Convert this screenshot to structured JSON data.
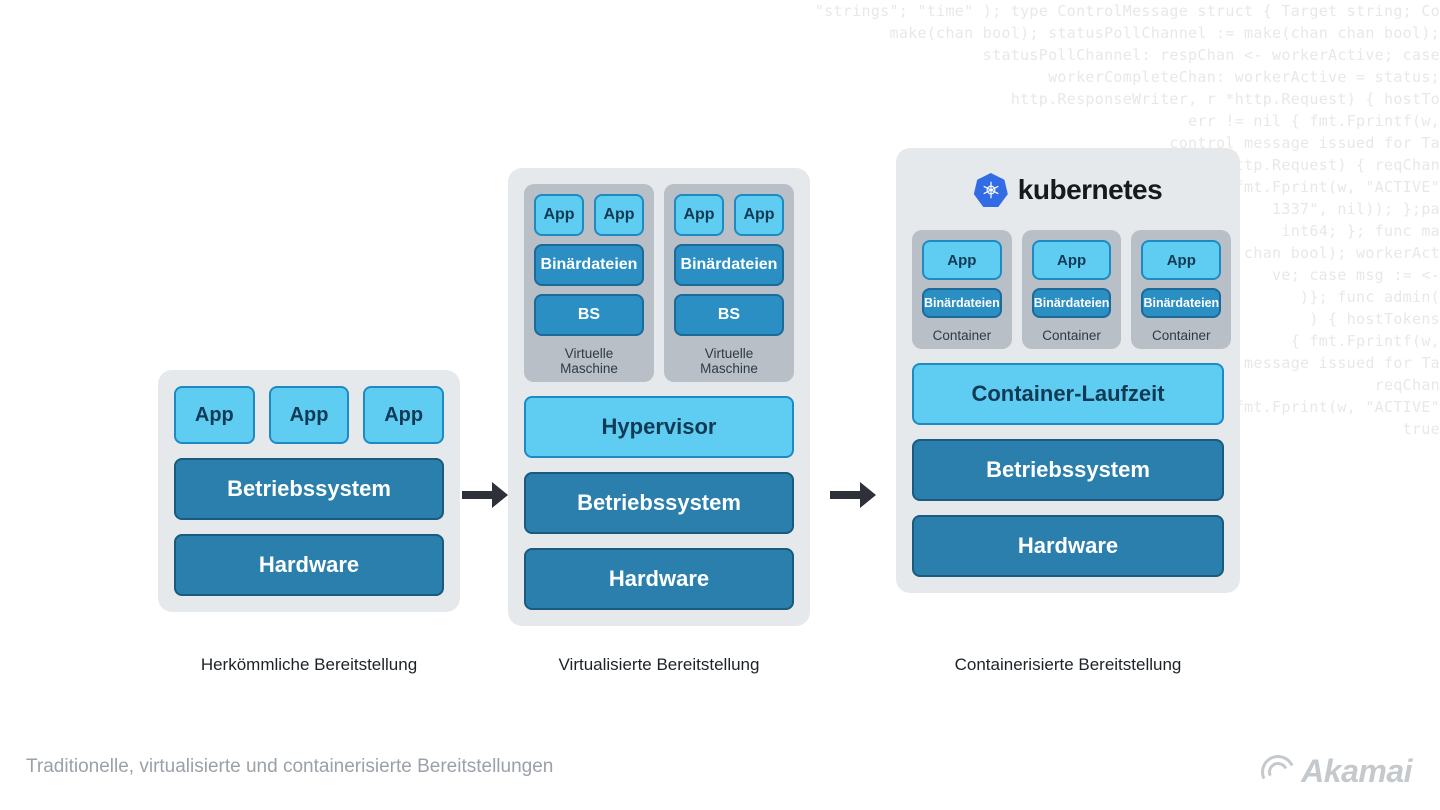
{
  "background_code": "\"strings\"; \"time\" ); type ControlMessage struct { Target string; Co\nmake(chan bool); statusPollChannel := make(chan chan bool);\nstatusPollChannel: respChan <- workerActive; case\nworkerCompleteChan: workerActive = status;\nhttp.ResponseWriter, r *http.Request) { hostTo\n  err != nil { fmt.Fprintf(w,\n  control message issued for Ta\n  http.Request) { reqChan\n  fmt.Fprint(w, \"ACTIVE\"\n1337\", nil)); };pa\nint64; }; func ma\nchan bool); workerAct\nve; case msg := <-\n)}; func admin(\n) { hostTokens\n{ fmt.Fprintf(w,\nmessage issued for Ta\nreqChan\nfmt.Fprint(w, \"ACTIVE\"\ntrue\n",
  "labels": {
    "app": "App",
    "binaries": "Binärdateien",
    "os_short": "BS",
    "vm": "Virtuelle Maschine",
    "hypervisor": "Hypervisor",
    "os": "Betriebssystem",
    "hardware": "Hardware",
    "k8s": "kubernetes",
    "container": "Container",
    "container_runtime": "Container-Laufzeit"
  },
  "captions": {
    "traditional": "Herkömmliche Bereitstellung",
    "virtual": "Virtualisierte Bereitstellung",
    "container": "Containerisierte Bereitstellung"
  },
  "footer": "Traditionelle, virtualisierte und containerisierte Bereitstellungen",
  "brand": "Akamai",
  "colors": {
    "light_blue": "#5fcdf2",
    "mid_blue": "#2c8fc4",
    "dark_blue": "#2a7fad",
    "panel_bg": "#e6e9ec",
    "group_bg": "#b8bfc6",
    "k8s_blue": "#326ce5"
  }
}
